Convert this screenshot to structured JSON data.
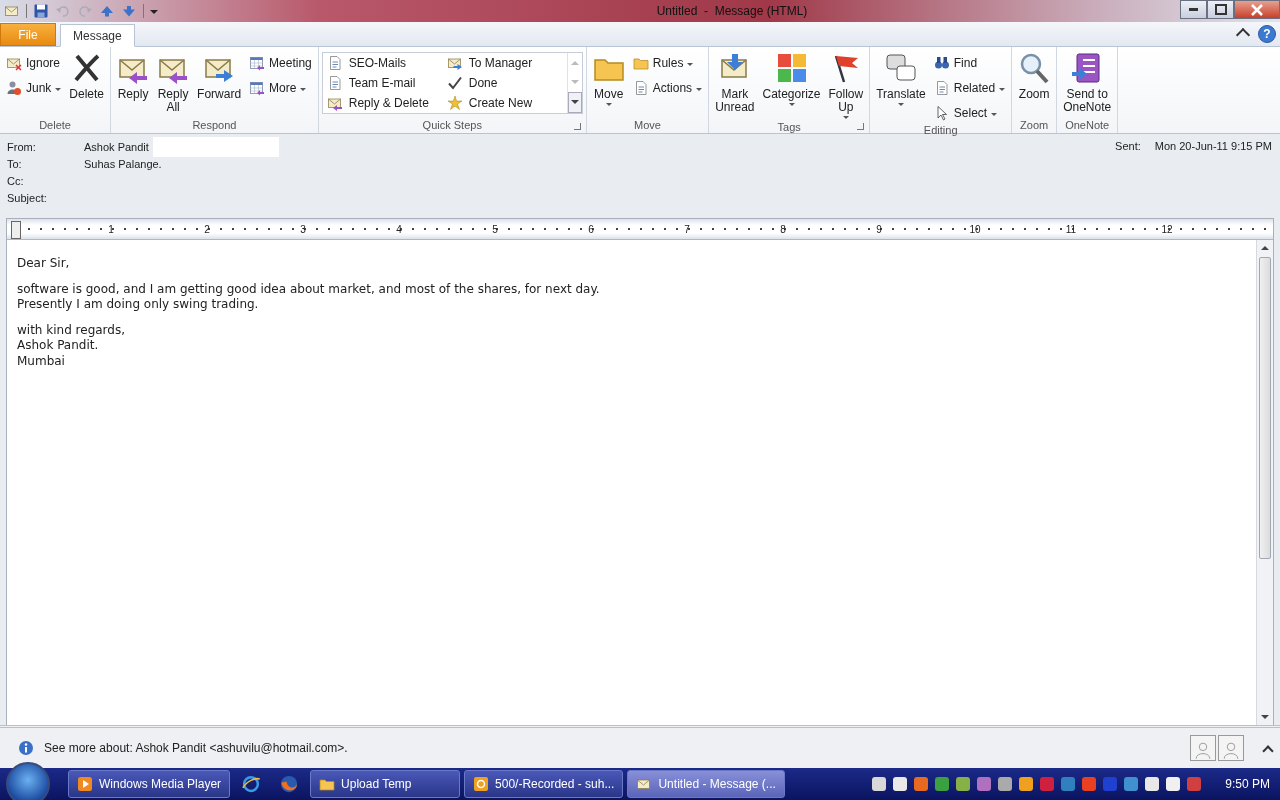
{
  "window": {
    "title": "Untitled  -  Message (HTML)"
  },
  "tabs": [
    {
      "label": "File",
      "kind": "file",
      "selected": false
    },
    {
      "label": "Message",
      "kind": "tab",
      "selected": true
    }
  ],
  "help": "?",
  "ribbon": [
    {
      "label": "Delete",
      "launcher": false,
      "columns": [
        {
          "kind": "stack",
          "items": [
            {
              "label": "Ignore",
              "dropdown": false
            },
            {
              "label": "Junk",
              "dropdown": true
            }
          ]
        },
        {
          "kind": "large",
          "label": "Delete",
          "dropdown": false
        }
      ]
    },
    {
      "label": "Respond",
      "launcher": false,
      "columns": [
        {
          "kind": "large",
          "label": "Reply",
          "dropdown": false
        },
        {
          "kind": "large",
          "label": "Reply\nAll",
          "dropdown": false
        },
        {
          "kind": "large",
          "label": "Forward",
          "dropdown": false
        },
        {
          "kind": "stack",
          "items": [
            {
              "label": "Meeting",
              "dropdown": false
            },
            {
              "label": "More",
              "dropdown": true
            }
          ]
        }
      ]
    },
    {
      "label": "Quick Steps",
      "launcher": true,
      "columns": [
        {
          "kind": "gallery",
          "items": [
            {
              "label": "SEO-Mails"
            },
            {
              "label": "To Manager"
            },
            {
              "label": "Team E-mail"
            },
            {
              "label": "Done"
            },
            {
              "label": "Reply & Delete"
            },
            {
              "label": "Create New"
            }
          ]
        }
      ]
    },
    {
      "label": "Move",
      "launcher": false,
      "columns": [
        {
          "kind": "large",
          "label": "Move",
          "dropdown": true
        },
        {
          "kind": "stack",
          "items": [
            {
              "label": "Rules",
              "dropdown": true
            },
            {
              "label": "Actions",
              "dropdown": true
            }
          ]
        }
      ]
    },
    {
      "label": "Tags",
      "launcher": true,
      "columns": [
        {
          "kind": "large",
          "label": "Mark\nUnread",
          "dropdown": false
        },
        {
          "kind": "large",
          "label": "Categorize",
          "dropdown": true
        },
        {
          "kind": "large",
          "label": "Follow\nUp",
          "dropdown": true
        }
      ]
    },
    {
      "label": "Editing",
      "launcher": false,
      "columns": [
        {
          "kind": "large",
          "label": "Translate",
          "dropdown": true
        },
        {
          "kind": "stack",
          "items": [
            {
              "label": "Find",
              "dropdown": false
            },
            {
              "label": "Related",
              "dropdown": true
            },
            {
              "label": "Select",
              "dropdown": true
            }
          ]
        }
      ]
    },
    {
      "label": "Zoom",
      "launcher": false,
      "columns": [
        {
          "kind": "large",
          "label": "Zoom",
          "dropdown": false
        }
      ]
    },
    {
      "label": "OneNote",
      "launcher": false,
      "columns": [
        {
          "kind": "large",
          "label": "Send to\nOneNote",
          "dropdown": false
        }
      ]
    }
  ],
  "header": {
    "fields": [
      {
        "label": "From:",
        "value": "Ashok Pandit"
      },
      {
        "label": "To:",
        "value": "Suhas Palange."
      },
      {
        "label": "Cc:"
      },
      {
        "label": "Subject:"
      }
    ],
    "sent_label": "Sent:",
    "sent_value": "Mon 20-Jun-11 9:15 PM"
  },
  "ruler": [
    "1",
    "2",
    "3",
    "4",
    "5",
    "6",
    "7",
    "8",
    "9",
    "10",
    "11",
    "12"
  ],
  "body": [
    [
      "Dear Sir,"
    ],
    [
      "software is good, and I am getting good idea about market, and most of the shares, for next day.",
      "Presently I am doing only swing trading."
    ],
    [
      "with kind regards,",
      "Ashok Pandit.",
      "Mumbai"
    ]
  ],
  "people_pane": {
    "text": "See more about: Ashok Pandit <ashuvilu@hotmail.com>."
  },
  "taskbar": {
    "tasks": [
      {
        "label": "Windows Media Player",
        "kind": "media",
        "selected": false
      },
      {
        "kind": "pin-browser"
      },
      {
        "kind": "pin-fox"
      },
      {
        "label": "Upload Temp",
        "kind": "folder",
        "selected": false
      },
      {
        "label": "500/-Recorded - suh...",
        "kind": "outlook",
        "selected": false
      },
      {
        "label": "Untitled - Message (...",
        "kind": "mail",
        "selected": true
      }
    ],
    "clock": "9:50 PM"
  }
}
